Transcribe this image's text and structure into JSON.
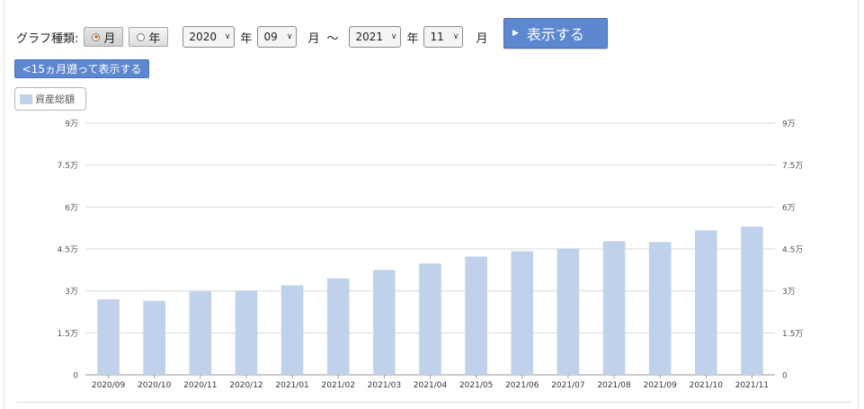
{
  "controls": {
    "graph_type_label": "グラフ種類:",
    "radio_month": "月",
    "radio_year": "年",
    "from_year": "2020",
    "from_year_unit": "年",
    "from_month": "09",
    "from_month_unit": "月",
    "tilde": "～",
    "to_year": "2021",
    "to_year_unit": "年",
    "to_month": "11",
    "to_month_unit": "月",
    "show_button": "表示する",
    "back_button": "<15ヵ月遡って表示する"
  },
  "colors": {
    "bar": "#bfd1eb",
    "button": "#5d87cf",
    "grid": "#d9d9d9"
  },
  "chart_data": {
    "type": "bar",
    "categories": [
      "2020/09",
      "2020/10",
      "2020/11",
      "2020/12",
      "2021/01",
      "2021/02",
      "2021/03",
      "2021/04",
      "2021/05",
      "2021/06",
      "2021/07",
      "2021/08",
      "2021/09",
      "2021/10",
      "2021/11"
    ],
    "series": [
      {
        "name": "資産総額",
        "values": [
          27000,
          26500,
          29800,
          30100,
          32000,
          34500,
          37500,
          39800,
          42300,
          44200,
          45200,
          47800,
          47500,
          51700,
          53000
        ]
      }
    ],
    "ylim": [
      0,
      90000
    ],
    "yticks": [
      "0",
      "1.5万",
      "3万",
      "4.5万",
      "6万",
      "7.5万",
      "9万"
    ],
    "ytick_values": [
      0,
      15000,
      30000,
      45000,
      60000,
      75000,
      90000
    ],
    "grid": true,
    "legend_position": "top-left",
    "dual_y_axis": true
  }
}
